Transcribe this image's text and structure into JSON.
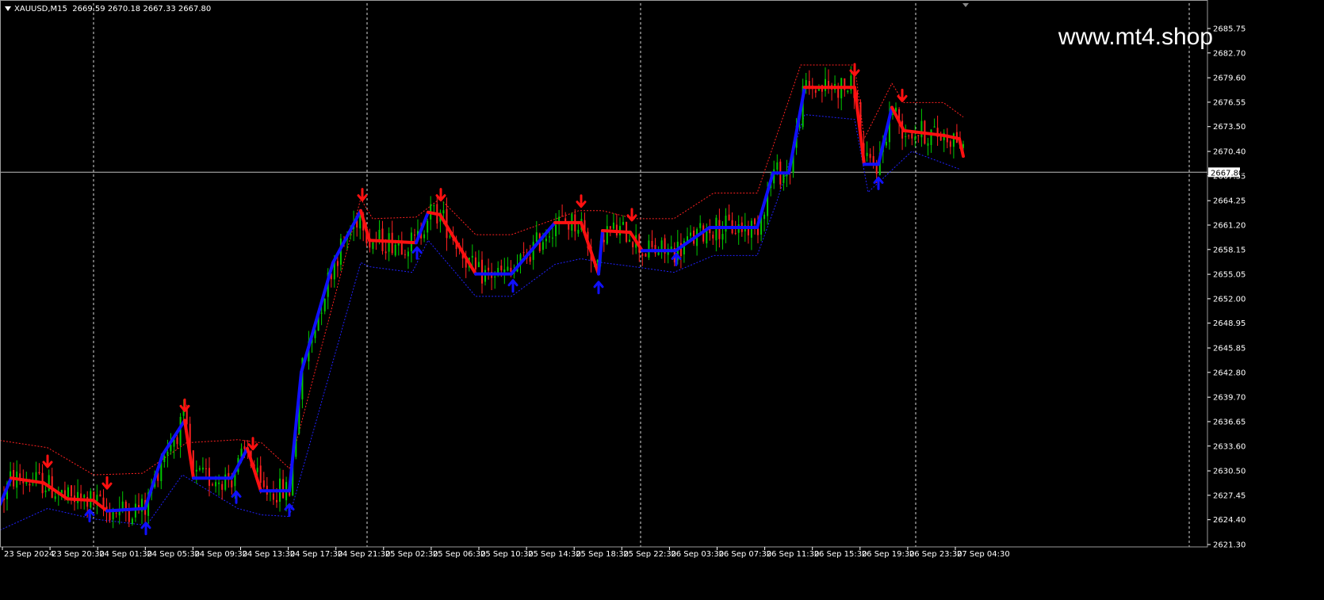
{
  "chart": {
    "symbol": "XAUUSD,M15",
    "ohlc": "2669.59 2670.18 2667.33 2667.80",
    "watermark": "www.mt4.shop",
    "current_price": "2667.80",
    "colors": {
      "background": "#000000",
      "bull": "#00c800",
      "bear": "#ff2020",
      "trend_up": "#1010ff",
      "trend_down": "#ff1010",
      "grid": "#ffffff",
      "price_line": "#bfbfbf"
    },
    "price_labels": [
      "2685.75",
      "2682.70",
      "2679.60",
      "2676.55",
      "2673.50",
      "2670.40",
      "2667.35",
      "2664.25",
      "2661.20",
      "2658.15",
      "2655.05",
      "2652.00",
      "2648.95",
      "2645.85",
      "2642.80",
      "2639.70",
      "2636.65",
      "2633.60",
      "2630.50",
      "2627.45",
      "2624.40",
      "2621.30"
    ],
    "time_labels": [
      "23 Sep 2024",
      "23 Sep 20:30",
      "24 Sep 01:30",
      "24 Sep 05:30",
      "24 Sep 09:30",
      "24 Sep 13:30",
      "24 Sep 17:30",
      "24 Sep 21:30",
      "25 Sep 02:30",
      "25 Sep 06:30",
      "25 Sep 10:30",
      "25 Sep 14:30",
      "25 Sep 18:30",
      "25 Sep 22:30",
      "26 Sep 03:30",
      "26 Sep 07:30",
      "26 Sep 11:30",
      "26 Sep 15:30",
      "26 Sep 19:30",
      "26 Sep 23:30",
      "27 Sep 04:30"
    ]
  },
  "chart_data": {
    "type": "candlestick",
    "y_range": [
      2621.3,
      2687.3
    ],
    "trend_line": [
      [
        0,
        2626.3
      ],
      [
        14,
        2629.6
      ],
      [
        55,
        2629.0
      ],
      [
        85,
        2627.0
      ],
      [
        118,
        2626.8
      ],
      [
        135,
        2625.5
      ],
      [
        183,
        2625.8
      ],
      [
        205,
        2632.5
      ],
      [
        233,
        2636.8
      ],
      [
        244,
        2629.6
      ],
      [
        292,
        2629.6
      ],
      [
        312,
        2633.3
      ],
      [
        329,
        2628.0
      ],
      [
        365,
        2628.0
      ],
      [
        380,
        2642.8
      ],
      [
        420,
        2656.5
      ],
      [
        455,
        2663.0
      ],
      [
        466,
        2659.3
      ],
      [
        525,
        2659.0
      ],
      [
        540,
        2662.8
      ],
      [
        555,
        2662.5
      ],
      [
        600,
        2655.1
      ],
      [
        645,
        2655.1
      ],
      [
        700,
        2661.5
      ],
      [
        733,
        2661.5
      ],
      [
        755,
        2655.1
      ],
      [
        760,
        2660.5
      ],
      [
        795,
        2660.3
      ],
      [
        810,
        2658.0
      ],
      [
        852,
        2658.0
      ],
      [
        895,
        2660.9
      ],
      [
        955,
        2660.9
      ],
      [
        975,
        2667.7
      ],
      [
        995,
        2667.7
      ],
      [
        1015,
        2678.4
      ],
      [
        1078,
        2678.4
      ],
      [
        1090,
        2668.8
      ],
      [
        1108,
        2668.8
      ],
      [
        1125,
        2675.9
      ],
      [
        1140,
        2673.0
      ],
      [
        1190,
        2672.4
      ],
      [
        1210,
        2672.0
      ],
      [
        1215,
        2669.8
      ]
    ],
    "upper_band": [
      [
        0,
        2634.3
      ],
      [
        60,
        2633.4
      ],
      [
        118,
        2630.0
      ],
      [
        180,
        2630.2
      ],
      [
        235,
        2634.0
      ],
      [
        300,
        2634.4
      ],
      [
        330,
        2634.0
      ],
      [
        365,
        2630.8
      ],
      [
        455,
        2664.5
      ],
      [
        470,
        2662.0
      ],
      [
        525,
        2662.2
      ],
      [
        555,
        2664.5
      ],
      [
        600,
        2660.0
      ],
      [
        645,
        2660.0
      ],
      [
        730,
        2663.0
      ],
      [
        760,
        2663.0
      ],
      [
        800,
        2662.0
      ],
      [
        850,
        2662.0
      ],
      [
        900,
        2665.2
      ],
      [
        955,
        2665.2
      ],
      [
        1010,
        2681.2
      ],
      [
        1078,
        2681.2
      ],
      [
        1090,
        2672.0
      ],
      [
        1125,
        2678.9
      ],
      [
        1140,
        2676.5
      ],
      [
        1190,
        2676.5
      ],
      [
        1215,
        2674.7
      ]
    ],
    "lower_band": [
      [
        0,
        2623.1
      ],
      [
        60,
        2625.8
      ],
      [
        118,
        2624.5
      ],
      [
        185,
        2623.7
      ],
      [
        230,
        2630.0
      ],
      [
        300,
        2625.8
      ],
      [
        330,
        2625.0
      ],
      [
        365,
        2624.8
      ],
      [
        455,
        2656.5
      ],
      [
        466,
        2656.0
      ],
      [
        520,
        2655.3
      ],
      [
        540,
        2659.3
      ],
      [
        600,
        2652.3
      ],
      [
        645,
        2652.3
      ],
      [
        700,
        2656.3
      ],
      [
        733,
        2657.0
      ],
      [
        760,
        2656.5
      ],
      [
        800,
        2656.0
      ],
      [
        850,
        2655.3
      ],
      [
        900,
        2657.4
      ],
      [
        955,
        2657.4
      ],
      [
        980,
        2664.2
      ],
      [
        1015,
        2675.0
      ],
      [
        1078,
        2674.4
      ],
      [
        1095,
        2665.3
      ],
      [
        1150,
        2670.4
      ],
      [
        1210,
        2668.2
      ]
    ],
    "sell_arrows": [
      [
        60,
        2631.6
      ],
      [
        135,
        2628.9
      ],
      [
        233,
        2638.6
      ],
      [
        319,
        2633.8
      ],
      [
        457,
        2664.9
      ],
      [
        556,
        2664.9
      ],
      [
        733,
        2664.1
      ],
      [
        797,
        2662.4
      ],
      [
        1078,
        2680.5
      ],
      [
        1138,
        2677.3
      ]
    ],
    "buy_arrows": [
      [
        113,
        2625.0
      ],
      [
        184,
        2623.4
      ],
      [
        298,
        2627.3
      ],
      [
        365,
        2625.7
      ],
      [
        526,
        2657.8
      ],
      [
        647,
        2653.7
      ],
      [
        755,
        2653.5
      ],
      [
        853,
        2657.0
      ],
      [
        1108,
        2666.5
      ]
    ],
    "candle_x_range": [
      5,
      1215
    ],
    "candle_count": 300
  }
}
